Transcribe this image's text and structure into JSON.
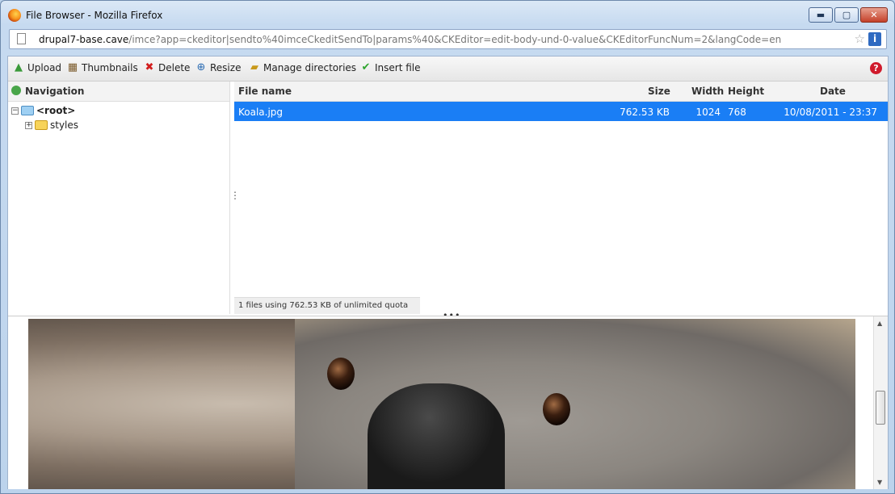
{
  "window": {
    "title": "File Browser - Mozilla Firefox",
    "buttons": {
      "minimize": "▬",
      "maximize": "▢",
      "close": "✕"
    }
  },
  "urlbar": {
    "domain": "drupal7-base.cave",
    "path": "/imce?app=ckeditor|sendto%40imceCkeditSendTo|params%40&CKEditor=edit-body-und-0-value&CKEditorFuncNum=2&langCode=en",
    "star_glyph": "☆",
    "info_glyph": "i"
  },
  "toolbar": {
    "upload": "Upload",
    "thumbnails": "Thumbnails",
    "delete": "Delete",
    "resize": "Resize",
    "manage_directories": "Manage directories",
    "insert_file": "Insert file",
    "help_glyph": "?",
    "icons": {
      "upload": "▲",
      "thumbnails": "▦",
      "delete": "✖",
      "resize": "⊕",
      "manage": "▰",
      "insert": "✔"
    },
    "colors": {
      "upload": "#3a9a3a",
      "delete": "#d21d1d",
      "insert": "#2ea52e"
    }
  },
  "navigation": {
    "title": "Navigation",
    "tree": [
      {
        "label": "<root>",
        "expander": "−",
        "bold": true
      },
      {
        "label": "styles",
        "expander": "+",
        "bold": false
      }
    ]
  },
  "files": {
    "columns": {
      "name": "File name",
      "size": "Size",
      "width": "Width",
      "height": "Height",
      "date": "Date"
    },
    "rows": [
      {
        "name": "Koala.jpg",
        "size": "762.53 KB",
        "width": "1024",
        "height": "768",
        "date": "10/08/2011 - 23:37"
      }
    ],
    "selected_color": "#1a7ef5"
  },
  "status": "1 files using 762.53 KB of unlimited quota",
  "splitters": {
    "vertical": "⋮",
    "horizontal": "•••"
  },
  "preview": {
    "scroll_up": "▲",
    "scroll_down": "▼"
  }
}
